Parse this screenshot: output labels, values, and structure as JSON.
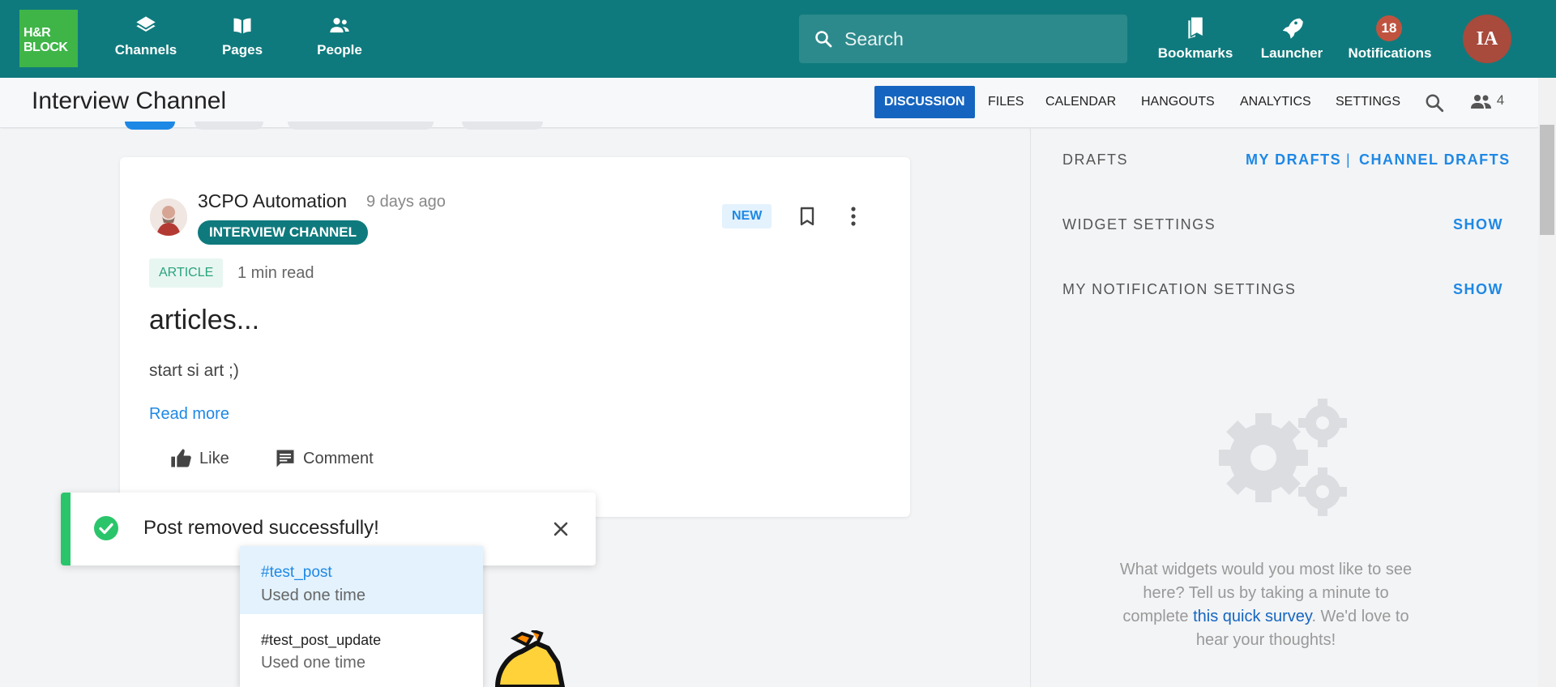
{
  "topbar": {
    "logo_line1": "H&R",
    "logo_line2": "BLOCK",
    "nav": [
      {
        "label": "Channels",
        "icon": "layers-icon"
      },
      {
        "label": "Pages",
        "icon": "book-icon"
      },
      {
        "label": "People",
        "icon": "people-icon"
      }
    ],
    "search_placeholder": "Search",
    "right": [
      {
        "label": "Bookmarks",
        "icon": "bookmarks-icon"
      },
      {
        "label": "Launcher",
        "icon": "rocket-icon"
      },
      {
        "label": "Notifications",
        "icon": "bell-icon"
      }
    ],
    "notification_count": "18",
    "user_initials": "IA"
  },
  "channel": {
    "title": "Interview Channel",
    "tabs": [
      "DISCUSSION",
      "FILES",
      "CALENDAR",
      "HANGOUTS",
      "ANALYTICS",
      "SETTINGS"
    ],
    "active_tab": "DISCUSSION",
    "member_count": "4"
  },
  "post": {
    "author": "3CPO Automation",
    "time": "9 days ago",
    "channel_chip": "INTERVIEW CHANNEL",
    "new_label": "NEW",
    "type": "ARTICLE",
    "read_time": "1 min read",
    "title": "articles...",
    "body": "start si art ;)",
    "read_more": "Read more",
    "like_label": "Like",
    "comment_label": "Comment"
  },
  "toast": {
    "message": "Post removed successfully!"
  },
  "hashtags": [
    {
      "tag": "#test_post",
      "uses": "Used one time"
    },
    {
      "tag": "#test_post_update",
      "uses": "Used one time"
    }
  ],
  "sidebar": {
    "drafts_label": "DRAFTS",
    "my_drafts": "MY DRAFTS",
    "separator": "|",
    "channel_drafts": "CHANNEL DRAFTS",
    "widget_settings": "WIDGET SETTINGS",
    "notification_settings": "MY NOTIFICATION SETTINGS",
    "show_label": "SHOW",
    "survey_before": "What widgets would you most like to see here? Tell us by taking a minute to complete ",
    "survey_link": "this quick survey",
    "survey_after": ". We'd love to hear your thoughts!"
  },
  "colors": {
    "topbar": "#0f7a7d",
    "logo": "#3fb548",
    "accent_blue": "#1e88e5",
    "active_tab": "#1565c0",
    "success": "#2ac56b"
  }
}
